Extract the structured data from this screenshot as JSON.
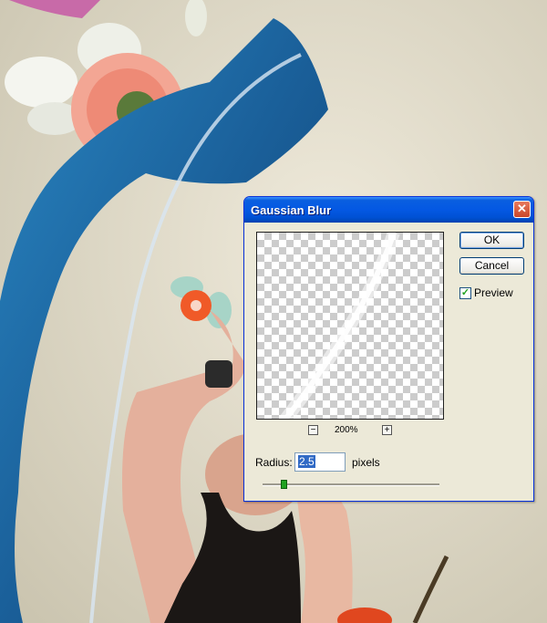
{
  "dialog": {
    "title": "Gaussian Blur",
    "close_symbol": "✕",
    "ok_label": "OK",
    "cancel_label": "Cancel",
    "preview_checkbox": {
      "label": "Preview",
      "checked": true,
      "check_symbol": "✓"
    },
    "zoom": {
      "value": "200%",
      "minus_symbol": "−",
      "plus_symbol": "+"
    },
    "radius": {
      "label": "Radius:",
      "value": "2.5",
      "unit": "pixels",
      "slider_fraction": 0.12
    }
  },
  "colors": {
    "titlebar": "#0458e3",
    "dialog_bg": "#ece9d8",
    "close_button": "#d2553a",
    "slider_thumb": "#21a121",
    "scarf": "#1f6eab"
  },
  "background_art": [
    "blue-scarf",
    "pink-gerbera-flower",
    "white-lily",
    "orange-plumeria",
    "woman-raising-arms"
  ]
}
